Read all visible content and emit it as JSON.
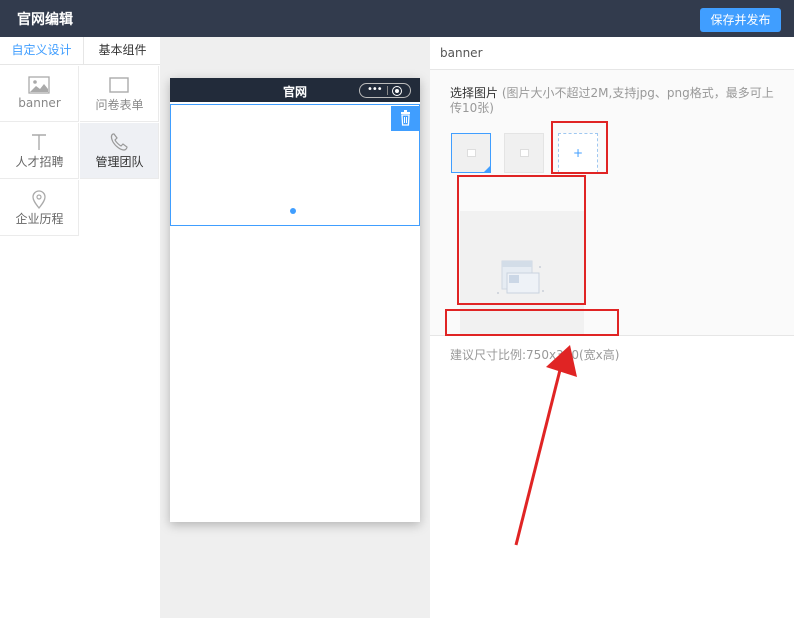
{
  "topbar": {
    "title": "官网编辑",
    "save_label": "保存并发布"
  },
  "left_tabs": [
    "自定义设计",
    "基本组件"
  ],
  "components": [
    {
      "label": "banner",
      "icon": "image-icon"
    },
    {
      "label": "问卷表单",
      "icon": "form-icon"
    },
    {
      "label": "人才招聘",
      "icon": "text-icon"
    },
    {
      "label": "管理团队",
      "icon": "phone-icon",
      "active": true
    },
    {
      "label": "企业历程",
      "icon": "location-pin-icon"
    }
  ],
  "phone": {
    "title": "官网"
  },
  "right_panel": {
    "header": "banner",
    "choose_label": "选择图片",
    "choose_note": "(图片大小不超过2M,支持jpg、png格式，最多可上传10张)",
    "add_label": "+",
    "hint": "建议尺寸比例:750x360(宽x高)"
  },
  "colors": {
    "topbar": "#323b4d",
    "accent": "#409eff",
    "annotation": "#e02424"
  }
}
